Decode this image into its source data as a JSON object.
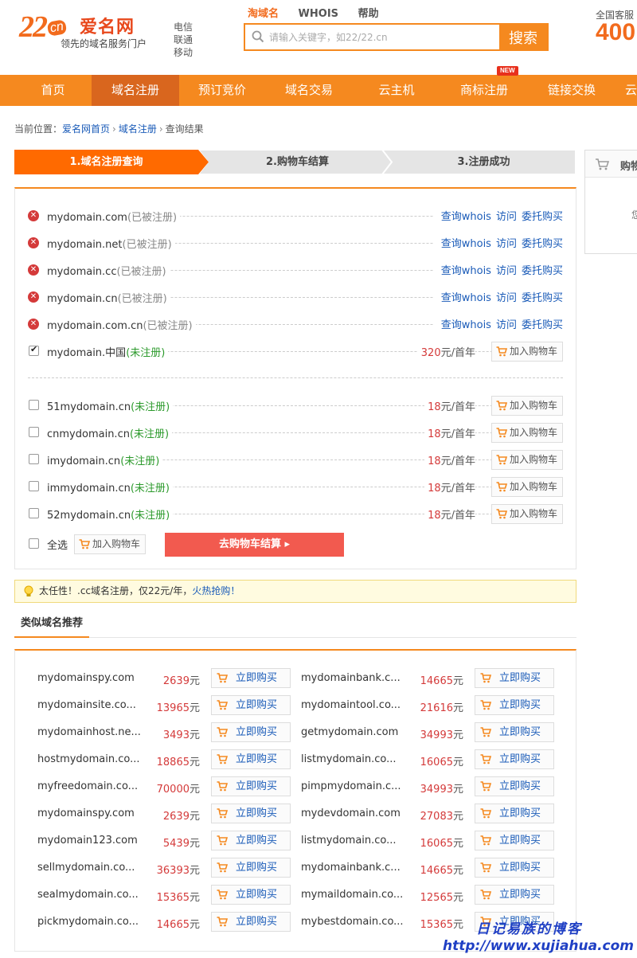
{
  "header": {
    "logo": {
      "num": "22",
      "tld": "cn",
      "name": "爱名网",
      "slogan": "领先的域名服务门户"
    },
    "carriers": [
      "电信",
      "联通",
      "移动"
    ],
    "search_tabs": [
      "淘域名",
      "WHOIS",
      "帮助"
    ],
    "search_placeholder": "请输入关键字，如22/22.cn",
    "search_button": "搜索",
    "hotline_label": "全国客服",
    "hotline_number": "400"
  },
  "nav": {
    "items": [
      "首页",
      "域名注册",
      "预订竞价",
      "域名交易",
      "云主机",
      "商标注册",
      "链接交换",
      "云"
    ],
    "active": "域名注册",
    "badge": "NEW"
  },
  "breadcrumb": {
    "label": "当前位置：",
    "items": [
      "爱名网首页",
      "域名注册",
      "查询结果"
    ]
  },
  "steps": [
    "1.域名注册查询",
    "2.购物车结算",
    "3.注册成功"
  ],
  "side_box": {
    "title": "购物",
    "text": "您"
  },
  "results": {
    "registered_state": "(已被注册)",
    "unregistered_state": "(未注册)",
    "link_whois": "查询whois",
    "link_visit": "访问",
    "link_buy": "委托购买",
    "cart_label": "加入购物车",
    "price_unit": "元/首年",
    "main": [
      {
        "name": "mydomain.com",
        "registered": true
      },
      {
        "name": "mydomain.net",
        "registered": true
      },
      {
        "name": "mydomain.cc",
        "registered": true
      },
      {
        "name": "mydomain.cn",
        "registered": true
      },
      {
        "name": "mydomain.com.cn",
        "registered": true
      },
      {
        "name": "mydomain.中国",
        "registered": false,
        "price": "320",
        "checked": true
      }
    ],
    "suggestions": [
      {
        "name": "51mydomain.cn",
        "price": "18"
      },
      {
        "name": "cnmydomain.cn",
        "price": "18"
      },
      {
        "name": "imydomain.cn",
        "price": "18"
      },
      {
        "name": "immydomain.cn",
        "price": "18"
      },
      {
        "name": "52mydomain.cn",
        "price": "18"
      }
    ],
    "select_all": "全选",
    "checkout": "去购物车结算 ▸"
  },
  "tip": {
    "text": "太任性！.cc域名注册，仅22元/年，",
    "hot": "火热抢购！"
  },
  "similar": {
    "tab": "类似域名推荐",
    "buy_label": "立即购买",
    "unit": "元",
    "left": [
      {
        "name": "mydomainspy.com",
        "price": "2639"
      },
      {
        "name": "mydomainsite.co...",
        "price": "13965"
      },
      {
        "name": "mydomainhost.ne...",
        "price": "3493"
      },
      {
        "name": "hostmydomain.co...",
        "price": "18865"
      },
      {
        "name": "myfreedomain.co...",
        "price": "70000"
      },
      {
        "name": "mydomainspy.com",
        "price": "2639"
      },
      {
        "name": "mydomain123.com",
        "price": "5439"
      },
      {
        "name": "sellmydomain.co...",
        "price": "36393"
      },
      {
        "name": "sealmydomain.co...",
        "price": "15365"
      },
      {
        "name": "pickmydomain.co...",
        "price": "14665"
      }
    ],
    "right": [
      {
        "name": "mydomainbank.c...",
        "price": "14665"
      },
      {
        "name": "mydomaintool.co...",
        "price": "21616"
      },
      {
        "name": "getmydomain.com",
        "price": "34993"
      },
      {
        "name": "listmydomain.co...",
        "price": "16065"
      },
      {
        "name": "pimpmydomain.c...",
        "price": "34993"
      },
      {
        "name": "mydevdomain.com",
        "price": "27083"
      },
      {
        "name": "listmydomain.co...",
        "price": "16065"
      },
      {
        "name": "mydomainbank.c...",
        "price": "14665"
      },
      {
        "name": "mymaildomain.co...",
        "price": "12565"
      },
      {
        "name": "mybestdomain.co...",
        "price": "15365"
      }
    ]
  },
  "watermark": {
    "line1": "日记易族的博客",
    "line2": "http://www.xujiahua.com"
  },
  "colors": {
    "brand_orange": "#f5891f",
    "nav_active": "#d9661e",
    "price_red": "#d43a3a",
    "link_blue": "#1a5bb8",
    "free_green": "#2c9a2c"
  }
}
